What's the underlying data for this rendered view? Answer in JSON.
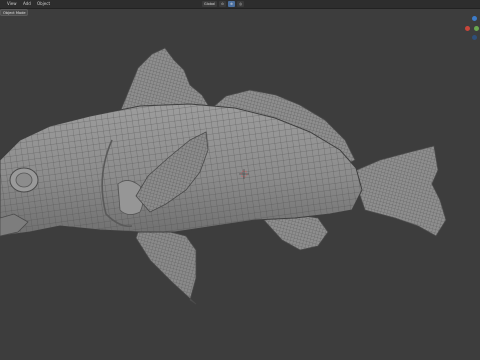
{
  "menu": {
    "view": "View",
    "add": "Add",
    "object": "Object"
  },
  "mode": {
    "label": "Object Mode"
  },
  "center_tools": {
    "transform": "Global",
    "pivot": "⊙",
    "snap": "⊕",
    "proportional": "◎"
  },
  "colors": {
    "viewport_bg": "#3d3d3d",
    "header_bg": "#2d2d2d",
    "mesh_fill": "#8f8f8f",
    "mesh_wire": "#4a4a4a",
    "gizmo_x": "#c8463a",
    "gizmo_y": "#6aa84f",
    "gizmo_z": "#3d7cc9"
  }
}
